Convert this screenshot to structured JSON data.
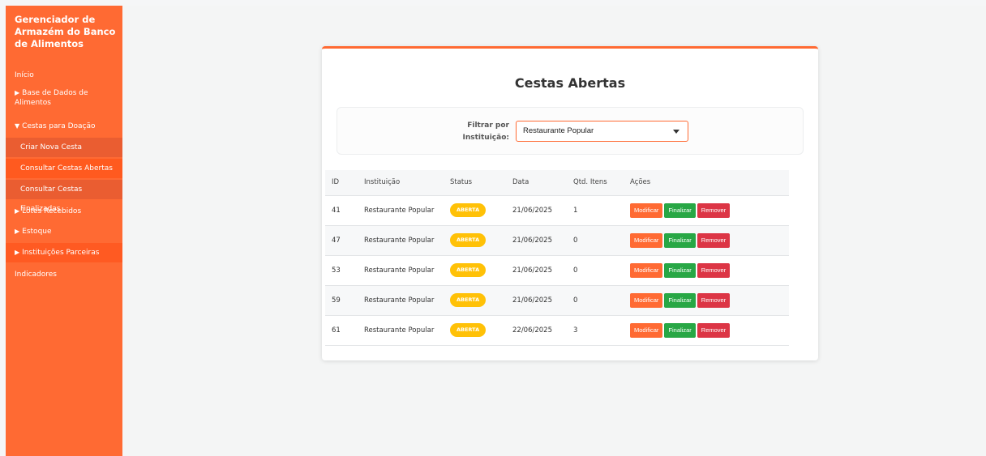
{
  "sidebar": {
    "title": "Gerenciador de Armazém do Banco de Alimentos",
    "items": [
      {
        "label": "Início"
      },
      {
        "label": "Base de Dados de Alimentos",
        "arrow": "▶"
      },
      {
        "label": "Cestas para Doação",
        "arrow": "▼"
      },
      {
        "label": "Criar Nova Cesta"
      },
      {
        "label": "Consultar Cestas Abertas"
      },
      {
        "label": "Consultar Cestas Finalizadas"
      },
      {
        "label": "Lotes Recebidos",
        "arrow": "▶"
      },
      {
        "label": "Estoque",
        "arrow": "▶"
      },
      {
        "label": "Instituições Parceiras",
        "arrow": "▶"
      },
      {
        "label": "Indicadores"
      }
    ]
  },
  "main": {
    "title": "Cestas Abertas",
    "filter": {
      "label": "Filtrar por Instituição:",
      "selected": "Restaurante Popular"
    },
    "table": {
      "headers": [
        "ID",
        "Instituição",
        "Status",
        "Data",
        "Qtd. Itens",
        "Ações"
      ],
      "rows": [
        {
          "id": "41",
          "instituicao": "Restaurante Popular",
          "status": "ABERTA",
          "data": "21/06/2025",
          "qtd": "1"
        },
        {
          "id": "47",
          "instituicao": "Restaurante Popular",
          "status": "ABERTA",
          "data": "21/06/2025",
          "qtd": "0"
        },
        {
          "id": "53",
          "instituicao": "Restaurante Popular",
          "status": "ABERTA",
          "data": "21/06/2025",
          "qtd": "0"
        },
        {
          "id": "59",
          "instituicao": "Restaurante Popular",
          "status": "ABERTA",
          "data": "21/06/2025",
          "qtd": "0"
        },
        {
          "id": "61",
          "instituicao": "Restaurante Popular",
          "status": "ABERTA",
          "data": "22/06/2025",
          "qtd": "3"
        }
      ],
      "actions": {
        "modify": "Modificar",
        "finish": "Finalizar",
        "remove": "Remover"
      }
    }
  },
  "colors": {
    "sidebar": "#ff6a33",
    "badge": "#ffc107",
    "modify": "#ff6a33",
    "finish": "#28a745",
    "remove": "#dc3545"
  }
}
